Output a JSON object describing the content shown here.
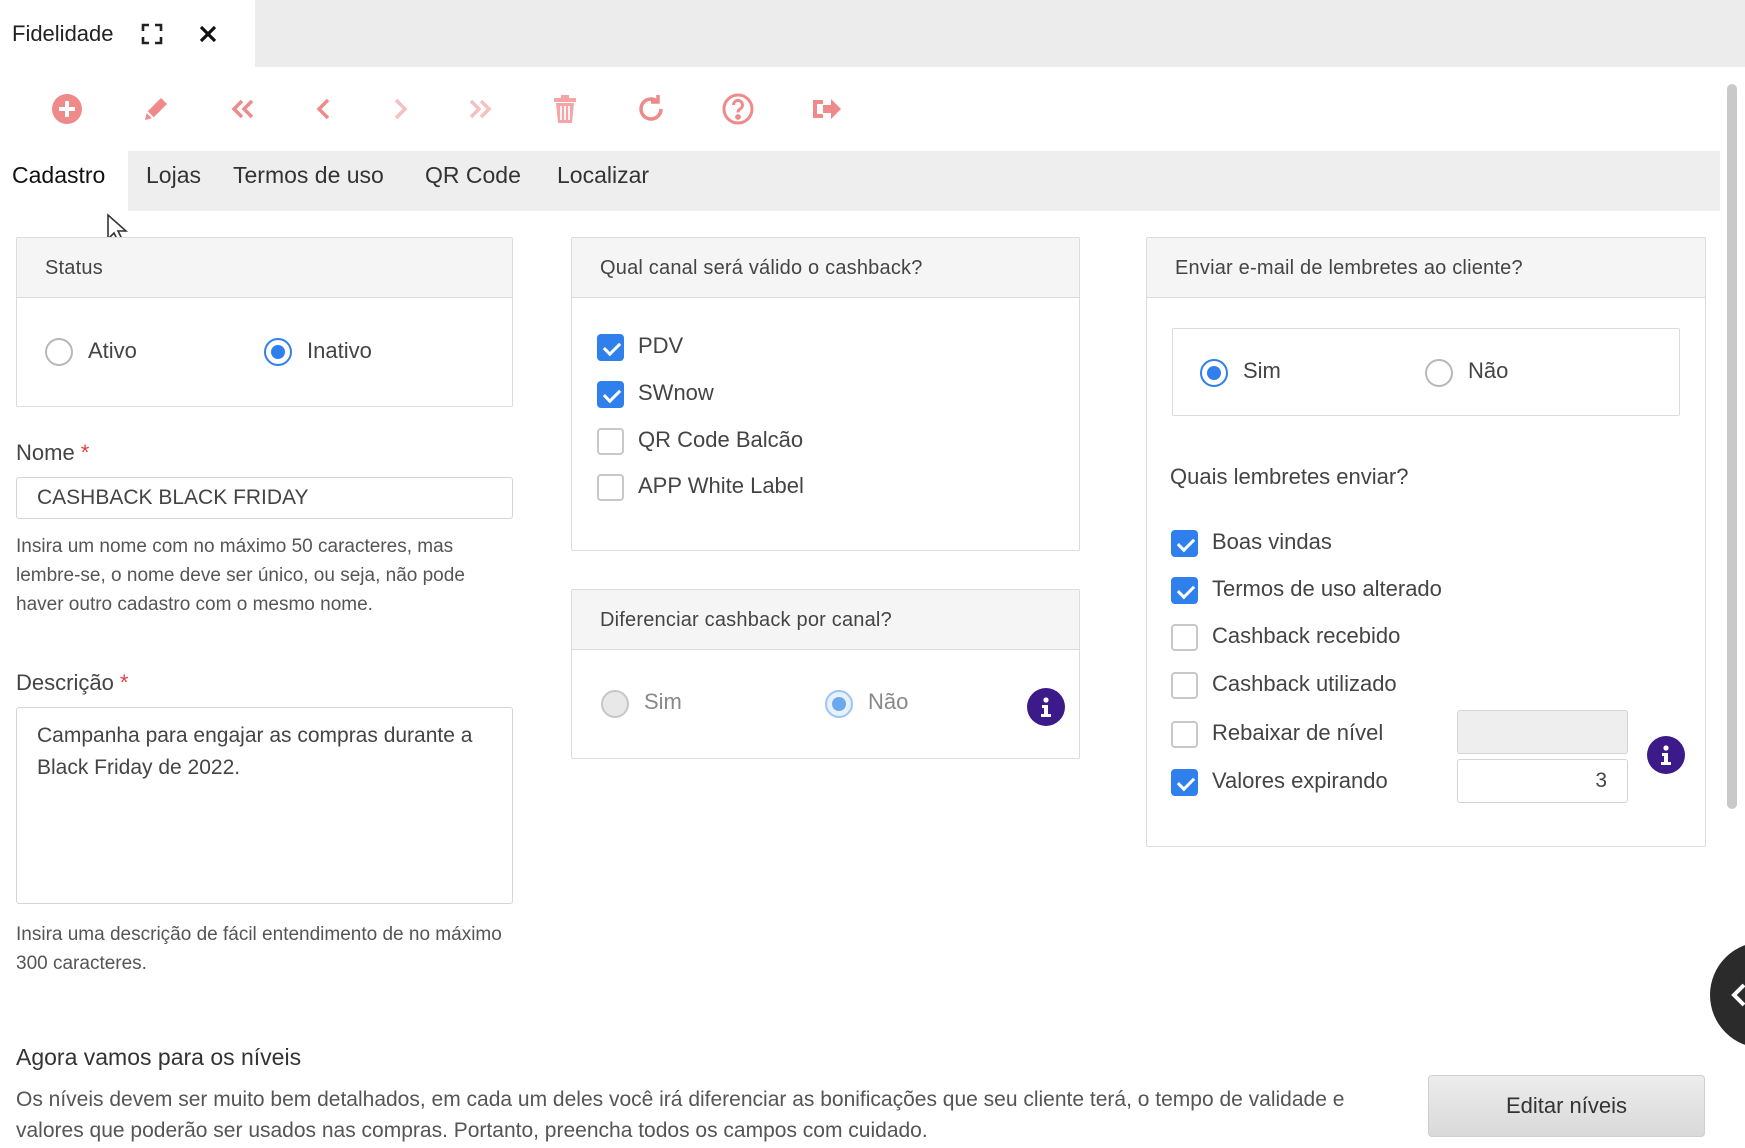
{
  "window": {
    "tab_title": "Fidelidade"
  },
  "toolbar_colors": {
    "icon": "#ef8a8a"
  },
  "tabs": [
    "Cadastro",
    "Lojas",
    "Termos de uso",
    "QR Code",
    "Localizar"
  ],
  "status": {
    "title": "Status",
    "options": [
      {
        "label": "Ativo",
        "selected": false
      },
      {
        "label": "Inativo",
        "selected": true
      }
    ]
  },
  "nome": {
    "label": "Nome",
    "required_mark": "*",
    "value": "CASHBACK BLACK FRIDAY",
    "help": "Insira um nome com no máximo 50 caracteres, mas lembre-se, o nome deve ser único, ou seja, não pode haver outro cadastro com o mesmo nome."
  },
  "descricao": {
    "label": "Descrição",
    "required_mark": "*",
    "value": "Campanha para engajar as compras durante a Black Friday de 2022.",
    "help": "Insira uma descrição de fácil entendimento de no máximo 300 caracteres."
  },
  "canal": {
    "title": "Qual canal será válido o cashback?",
    "options": [
      {
        "label": "PDV",
        "checked": true
      },
      {
        "label": "SWnow",
        "checked": true
      },
      {
        "label": "QR Code Balcão",
        "checked": false
      },
      {
        "label": "APP White Label",
        "checked": false
      }
    ]
  },
  "diferenciar": {
    "title": "Diferenciar cashback por canal?",
    "options": [
      {
        "label": "Sim",
        "selected": false
      },
      {
        "label": "Não",
        "selected": true
      }
    ]
  },
  "email": {
    "title": "Enviar e-mail de lembretes ao cliente?",
    "options": [
      {
        "label": "Sim",
        "selected": true
      },
      {
        "label": "Não",
        "selected": false
      }
    ],
    "lembretes_title": "Quais lembretes enviar?",
    "lembretes": [
      {
        "label": "Boas vindas",
        "checked": true
      },
      {
        "label": "Termos de uso alterado",
        "checked": true
      },
      {
        "label": "Cashback recebido",
        "checked": false
      },
      {
        "label": "Cashback utilizado",
        "checked": false
      },
      {
        "label": "Rebaixar de nível",
        "checked": false,
        "input_value": ""
      },
      {
        "label": "Valores expirando",
        "checked": true,
        "input_value": "3"
      }
    ]
  },
  "niveis": {
    "title": "Agora vamos para os níveis",
    "text": "Os níveis devem ser muito bem detalhados, em cada um deles você irá diferenciar as bonificações que seu cliente terá, o tempo de validade e valores que poderão ser usados nas compras. Portanto, preencha todos os campos com cuidado.",
    "button": "Editar níveis"
  }
}
